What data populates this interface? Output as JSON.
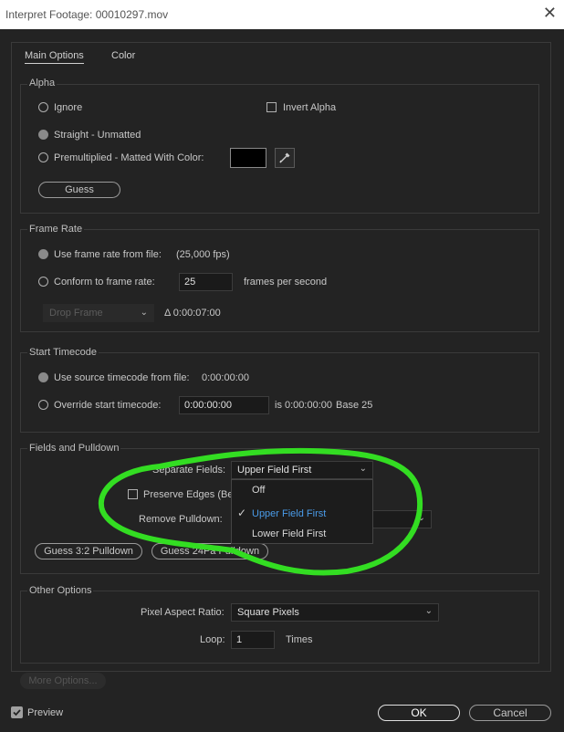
{
  "window": {
    "title": "Interpret Footage: 00010297.mov",
    "close": "✕"
  },
  "tabs": [
    {
      "label": "Main Options"
    },
    {
      "label": "Color"
    }
  ],
  "alpha": {
    "group_label": "Alpha",
    "ignore": "Ignore",
    "invert_alpha": "Invert Alpha",
    "straight": "Straight - Unmatted",
    "premultiplied": "Premultiplied - Matted With Color:",
    "guess": "Guess",
    "matte_color": "#000000"
  },
  "frame_rate": {
    "group_label": "Frame Rate",
    "use_from_file": "Use frame rate from file:",
    "file_fps": "(25,000 fps)",
    "conform": "Conform to frame rate:",
    "conform_value": "25",
    "fps_unit": "frames per second",
    "drop_frame": "Drop Frame",
    "duration": "Δ 0:00:07:00"
  },
  "start_timecode": {
    "group_label": "Start Timecode",
    "use_source": "Use source timecode from file:",
    "source_value": "0:00:00:00",
    "override": "Override start timecode:",
    "override_value": "0:00:00:00",
    "is_text": "is 0:00:00:00",
    "base": "Base 25"
  },
  "fields": {
    "group_label": "Fields and Pulldown",
    "separate_fields_label": "Separate Fields:",
    "separate_fields_value": "Upper Field First",
    "preserve_edges": "Preserve Edges (Be",
    "remove_pulldown_label": "Remove Pulldown:",
    "guess_32": "Guess 3:2 Pulldown",
    "guess_24pa": "Guess 24Pa Pulldown",
    "menu_options": [
      {
        "label": "Off"
      },
      {
        "label": "Upper Field First"
      },
      {
        "label": "Lower Field First"
      }
    ],
    "checkmark": "✓",
    "highlight_color": "#33dd22"
  },
  "other": {
    "group_label": "Other Options",
    "par_label": "Pixel Aspect Ratio:",
    "par_value": "Square Pixels",
    "loop_label": "Loop:",
    "loop_value": "1",
    "times": "Times"
  },
  "footer": {
    "more_options": "More Options...",
    "preview": "Preview",
    "ok": "OK",
    "cancel": "Cancel"
  },
  "accent_color": "#4a9be8"
}
